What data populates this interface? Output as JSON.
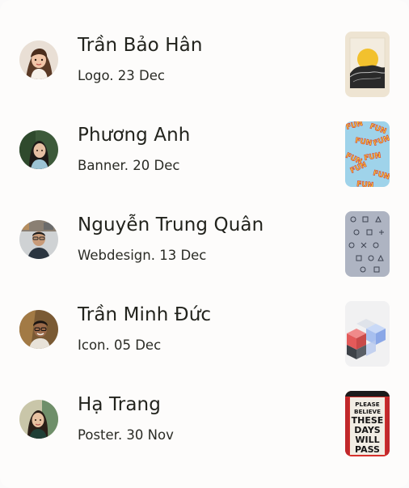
{
  "items": [
    {
      "name": "Trần Bảo Hân",
      "type": "Logo",
      "date": "23 Dec",
      "meta": "Logo. 23 Dec",
      "avatar_icon": "avatar-photo",
      "thumb_icon": "sun-landscape-thumbnail"
    },
    {
      "name": "Phương Anh",
      "type": "Banner",
      "date": "20 Dec",
      "meta": "Banner. 20 Dec",
      "avatar_icon": "avatar-photo",
      "thumb_icon": "fun-pattern-thumbnail"
    },
    {
      "name": "Nguyễn Trung Quân",
      "type": "Webdesign",
      "date": "13 Dec",
      "meta": "Webdesign. 13 Dec",
      "avatar_icon": "avatar-photo",
      "thumb_icon": "icon-grid-thumbnail"
    },
    {
      "name": "Trần Minh Đức",
      "type": "Icon",
      "date": "05 Dec",
      "meta": "Icon. 05 Dec",
      "avatar_icon": "avatar-photo",
      "thumb_icon": "3d-cubes-thumbnail"
    },
    {
      "name": "Hạ Trang",
      "type": "Poster",
      "date": "30 Nov",
      "meta": "Poster. 30 Nov",
      "avatar_icon": "avatar-photo",
      "thumb_icon": "typography-poster-thumbnail",
      "poster_text": [
        "PLEASE",
        "BELIEVE",
        "THESE",
        "DAYS",
        "WILL",
        "PASS"
      ]
    }
  ],
  "colors": {
    "background": "#fdfcfb",
    "text": "#22231d"
  }
}
